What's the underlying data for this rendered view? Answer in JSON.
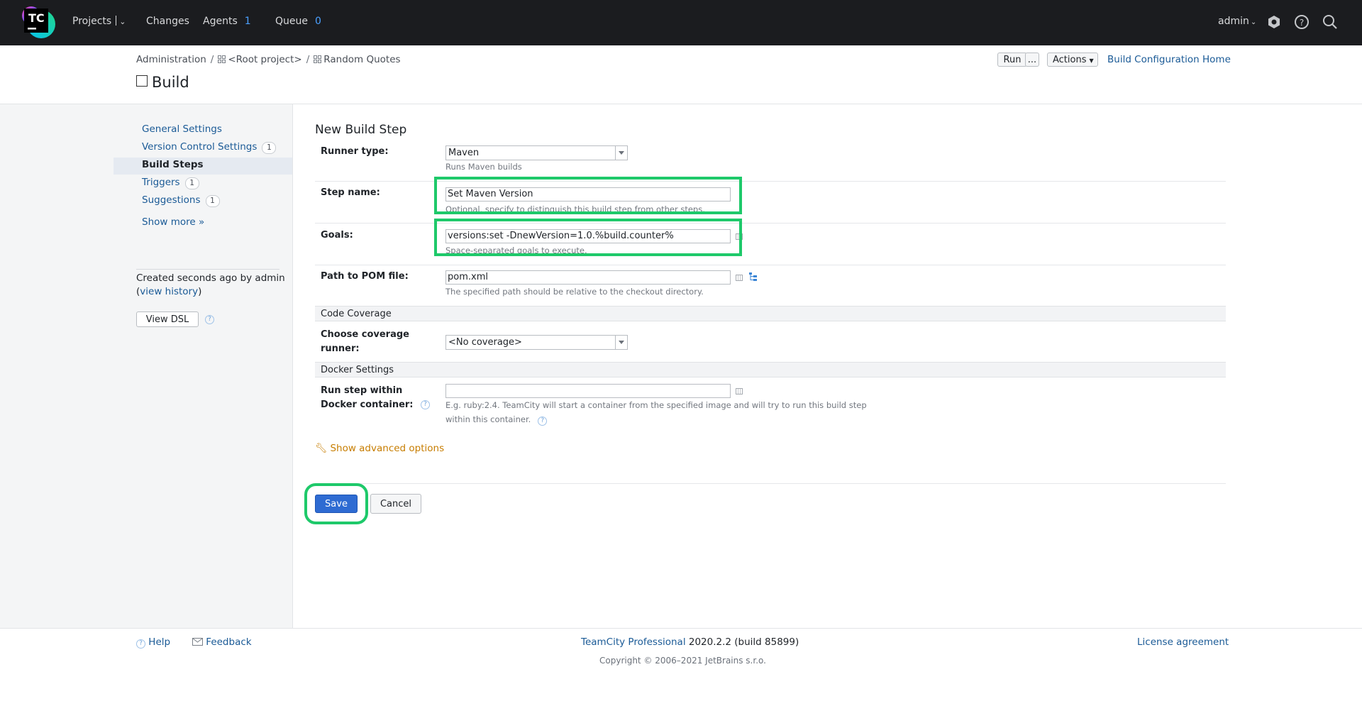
{
  "topbar": {
    "logo_text": "TC",
    "nav": {
      "projects": "Projects",
      "changes": "Changes",
      "agents": "Agents",
      "agents_count": "1",
      "queue": "Queue",
      "queue_count": "0"
    },
    "user": "admin"
  },
  "header": {
    "breadcrumb": [
      "Administration",
      "<Root project>",
      "Random Quotes"
    ],
    "breadcrumb_sep": "/",
    "title": "Build",
    "run_label": "Run",
    "run_more_label": "...",
    "actions_label": "Actions",
    "home_link": "Build Configuration Home"
  },
  "sidebar": {
    "items": [
      {
        "label": "General Settings",
        "badge": ""
      },
      {
        "label": "Version Control Settings",
        "badge": "1"
      },
      {
        "label": "Build Steps",
        "badge": ""
      },
      {
        "label": "Triggers",
        "badge": "1"
      },
      {
        "label": "Suggestions",
        "badge": "1"
      }
    ],
    "show_more": "Show more »",
    "created_text": "Created seconds ago by admin",
    "view_history": "view history",
    "view_dsl": "View DSL"
  },
  "form": {
    "section_title": "New Build Step",
    "runner_type_label": "Runner type:",
    "runner_type_value": "Maven",
    "runner_type_note": "Runs Maven builds",
    "step_name_label": "Step name:",
    "step_name_value": "Set Maven Version",
    "step_name_note": "Optional, specify to distinguish this build step from other steps.",
    "goals_label": "Goals:",
    "goals_value": "versions:set -DnewVersion=1.0.%build.counter%",
    "goals_note": "Space-separated goals to execute.",
    "pom_label": "Path to POM file:",
    "pom_value": "pom.xml",
    "pom_note": "The specified path should be relative to the checkout directory.",
    "code_coverage_header": "Code Coverage",
    "coverage_label_1": "Choose coverage",
    "coverage_label_2": "runner:",
    "coverage_value": "<No coverage>",
    "docker_header": "Docker Settings",
    "docker_label_1": "Run step within",
    "docker_label_2": "Docker container:",
    "docker_value": "",
    "docker_note_1": "E.g. ruby:2.4. TeamCity will start a container from the specified image and will try to run this build step",
    "docker_note_2": "within this container.",
    "advanced_options": "Show advanced options",
    "save": "Save",
    "cancel": "Cancel"
  },
  "footer": {
    "help": "Help",
    "feedback": "Feedback",
    "product_link": "TeamCity Professional",
    "version": "2020.2.2 (build 85899)",
    "copyright": "Copyright © 2006–2021 JetBrains s.r.o.",
    "license": "License agreement"
  },
  "colors": {
    "highlight": "#1ec96a",
    "link": "#1a5a96",
    "primary_button": "#2e6bd2",
    "topbar_bg": "#1b1c1f"
  }
}
